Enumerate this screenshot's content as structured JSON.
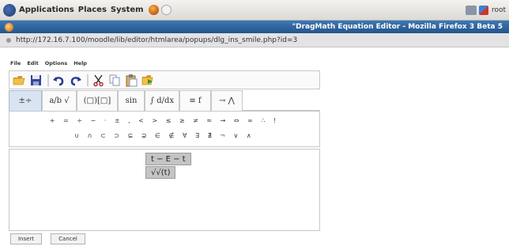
{
  "panel": {
    "menus": [
      "Applications",
      "Places",
      "System"
    ],
    "user": "root"
  },
  "window": {
    "title": "\"DragMath Equation Editor - Mozilla Firefox 3 Beta 5"
  },
  "urlbar": {
    "url": "http://172.16.7.100/moodle/lib/editor/htmlarea/popups/dlg_ins_smile.php?id=3"
  },
  "editor": {
    "menu": [
      "File",
      "Edit",
      "Options",
      "Help"
    ],
    "toolbar_icons": [
      "open-folder-icon",
      "save-disk-icon",
      "undo-icon",
      "redo-icon",
      "cut-scissors-icon",
      "copy-icon",
      "paste-icon",
      "export-icon"
    ],
    "tabs": [
      "±÷",
      "a/b √",
      "(□)[□]",
      "sin",
      "∫ d/dx",
      "≡ f",
      "→ ⋀"
    ],
    "symbols_row1": "+ = ÷ − · ± , < > ≤ ≥ ≠ ≈ → ⇔ ∞ ∴ !",
    "symbols_row2": "∪ ∩ ⊂ ⊃ ⊆ ⊇ ∈ ∉ ∀ ∃ ∄ ¬ ∨ ∧",
    "expression": [
      "t − E − t",
      "√√(t)"
    ],
    "buttons": {
      "insert": "Insert",
      "cancel": "Cancel"
    },
    "colors": {
      "active_tab": "#d9e4f2",
      "expression_bg": "#c4c4c4",
      "titlebar": "#2f6aa6"
    }
  }
}
